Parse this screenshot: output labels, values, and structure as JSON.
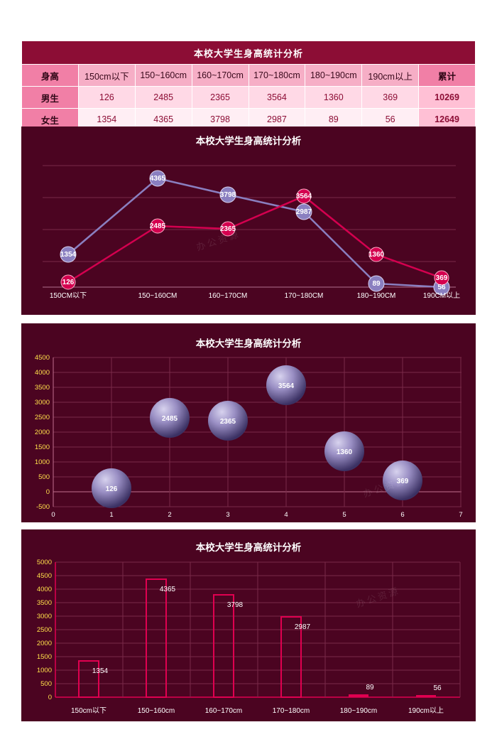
{
  "table": {
    "title": "本校大学生身高统计分析",
    "headers": [
      "身高",
      "150cm以下",
      "150~160cm",
      "160~170cm",
      "170~180cm",
      "180~190cm",
      "190cm以上",
      "累计"
    ],
    "rows": [
      {
        "label": "男生",
        "values": [
          "126",
          "2485",
          "2365",
          "3564",
          "1360",
          "369"
        ],
        "total": "10269"
      },
      {
        "label": "女生",
        "values": [
          "1354",
          "4365",
          "3798",
          "2987",
          "89",
          "56"
        ],
        "total": "12649"
      }
    ]
  },
  "watermark": "办公资源",
  "charts": {
    "line": {
      "title": "本校大学生身高统计分析",
      "x_tick_labels": [
        "150CM以下",
        "150~160CM",
        "160~170CM",
        "170~180CM",
        "180~190CM",
        "190CM以上"
      ],
      "series_male_labels": [
        "126",
        "2485",
        "2365",
        "3564",
        "1360",
        "369"
      ],
      "series_female_labels": [
        "1354",
        "4365",
        "3798",
        "2987",
        "89",
        "56"
      ],
      "color_male": "#d4004f",
      "color_female": "#8a7fc0"
    },
    "bubble": {
      "title": "本校大学生身高统计分析",
      "y_ticks": [
        "4500",
        "4000",
        "3500",
        "3000",
        "2500",
        "2000",
        "1500",
        "1000",
        "500",
        "0",
        "-500"
      ],
      "x_ticks": [
        "0",
        "1",
        "2",
        "3",
        "4",
        "5",
        "6",
        "7"
      ],
      "labels": [
        "126",
        "2485",
        "2365",
        "3564",
        "1360",
        "369"
      ],
      "bubble_color": "#9a8fc4"
    },
    "bar": {
      "title": "本校大学生身高统计分析",
      "y_ticks": [
        "5000",
        "4500",
        "4000",
        "3500",
        "3000",
        "2500",
        "2000",
        "1500",
        "1000",
        "500",
        "0"
      ],
      "x_tick_labels": [
        "150cm以下",
        "150~160cm",
        "160~170cm",
        "170~180cm",
        "180~190cm",
        "190cm以上"
      ],
      "labels": [
        "1354",
        "4365",
        "3798",
        "2987",
        "89",
        "56"
      ],
      "bar_color": "#e00050"
    }
  },
  "chart_data": [
    {
      "type": "line",
      "title": "本校大学生身高统计分析",
      "categories": [
        "150CM以下",
        "150~160CM",
        "160~170CM",
        "170~180CM",
        "180~190CM",
        "190CM以上"
      ],
      "series": [
        {
          "name": "男生",
          "values": [
            126,
            2485,
            2365,
            3564,
            1360,
            369
          ],
          "color": "#d4004f"
        },
        {
          "name": "女生",
          "values": [
            1354,
            4365,
            3798,
            2987,
            89,
            56
          ],
          "color": "#8a7fc0"
        }
      ],
      "xlabel": "",
      "ylabel": "",
      "ylim": [
        0,
        4600
      ],
      "grid": true,
      "legend": "none"
    },
    {
      "type": "scatter",
      "title": "本校大学生身高统计分析",
      "x": [
        1,
        2,
        3,
        4,
        5,
        6
      ],
      "values": [
        126,
        2485,
        2365,
        3564,
        1360,
        369
      ],
      "xlabel": "",
      "ylabel": "",
      "xlim": [
        0,
        7
      ],
      "ylim": [
        -500,
        4500
      ],
      "grid": true,
      "legend": "none"
    },
    {
      "type": "bar",
      "title": "本校大学生身高统计分析",
      "categories": [
        "150cm以下",
        "150~160cm",
        "160~170cm",
        "170~180cm",
        "180~190cm",
        "190cm以上"
      ],
      "values": [
        1354,
        4365,
        3798,
        2987,
        89,
        56
      ],
      "xlabel": "",
      "ylabel": "",
      "ylim": [
        0,
        5000
      ],
      "grid": true,
      "legend": "none"
    }
  ]
}
